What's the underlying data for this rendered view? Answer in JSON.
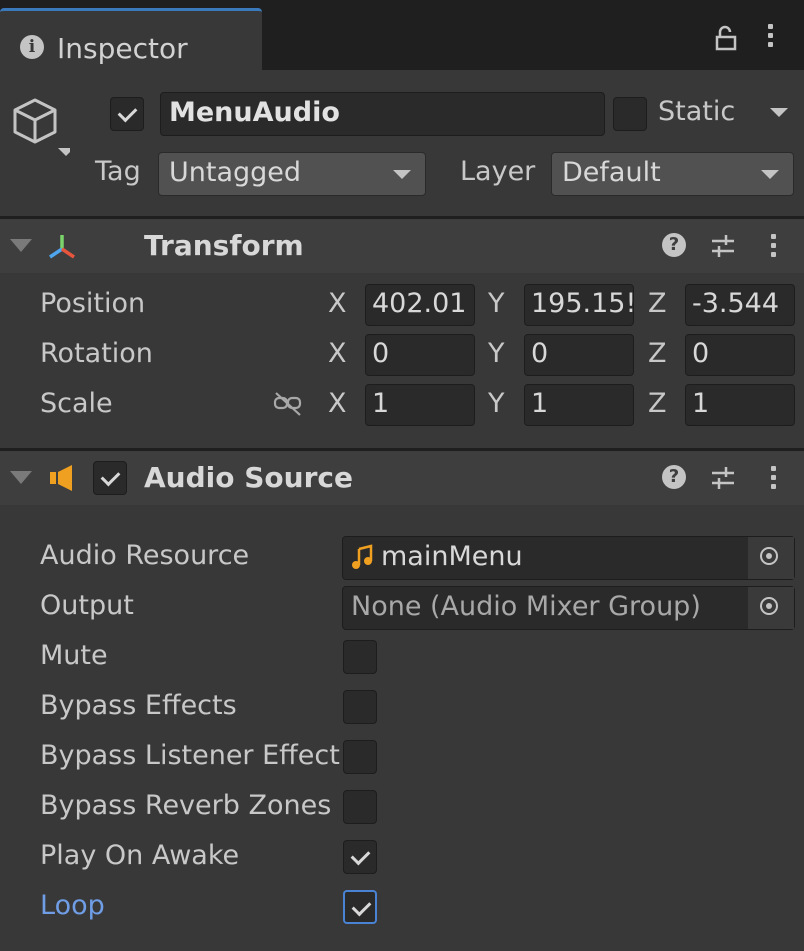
{
  "tab": {
    "title": "Inspector"
  },
  "gameobject": {
    "name": "MenuAudio",
    "active": true,
    "static_label": "Static",
    "static": false,
    "tag_label": "Tag",
    "tag": "Untagged",
    "layer_label": "Layer",
    "layer": "Default"
  },
  "transform": {
    "title": "Transform",
    "rows": [
      {
        "label": "Position",
        "x": "402.01",
        "y": "195.15!",
        "z": "-3.544"
      },
      {
        "label": "Rotation",
        "x": "0",
        "y": "0",
        "z": "0"
      },
      {
        "label": "Scale",
        "x": "1",
        "y": "1",
        "z": "1"
      }
    ],
    "axis": {
      "x": "X",
      "y": "Y",
      "z": "Z"
    }
  },
  "audio_source": {
    "title": "Audio Source",
    "enabled": true,
    "audio_resource_label": "Audio Resource",
    "audio_resource_value": "mainMenu",
    "output_label": "Output",
    "output_value": "None (Audio Mixer Group)",
    "mute_label": "Mute",
    "mute": false,
    "bypass_effects_label": "Bypass Effects",
    "bypass_effects": false,
    "bypass_listener_label": "Bypass Listener Effects",
    "bypass_listener": false,
    "bypass_reverb_label": "Bypass Reverb Zones",
    "bypass_reverb": false,
    "play_on_awake_label": "Play On Awake",
    "play_on_awake": true,
    "loop_label": "Loop",
    "loop": true
  },
  "colors": {
    "accent_blue": "#3a79bb",
    "loop_label": "#6f9ee6",
    "audio_icon": "#f0a020"
  }
}
